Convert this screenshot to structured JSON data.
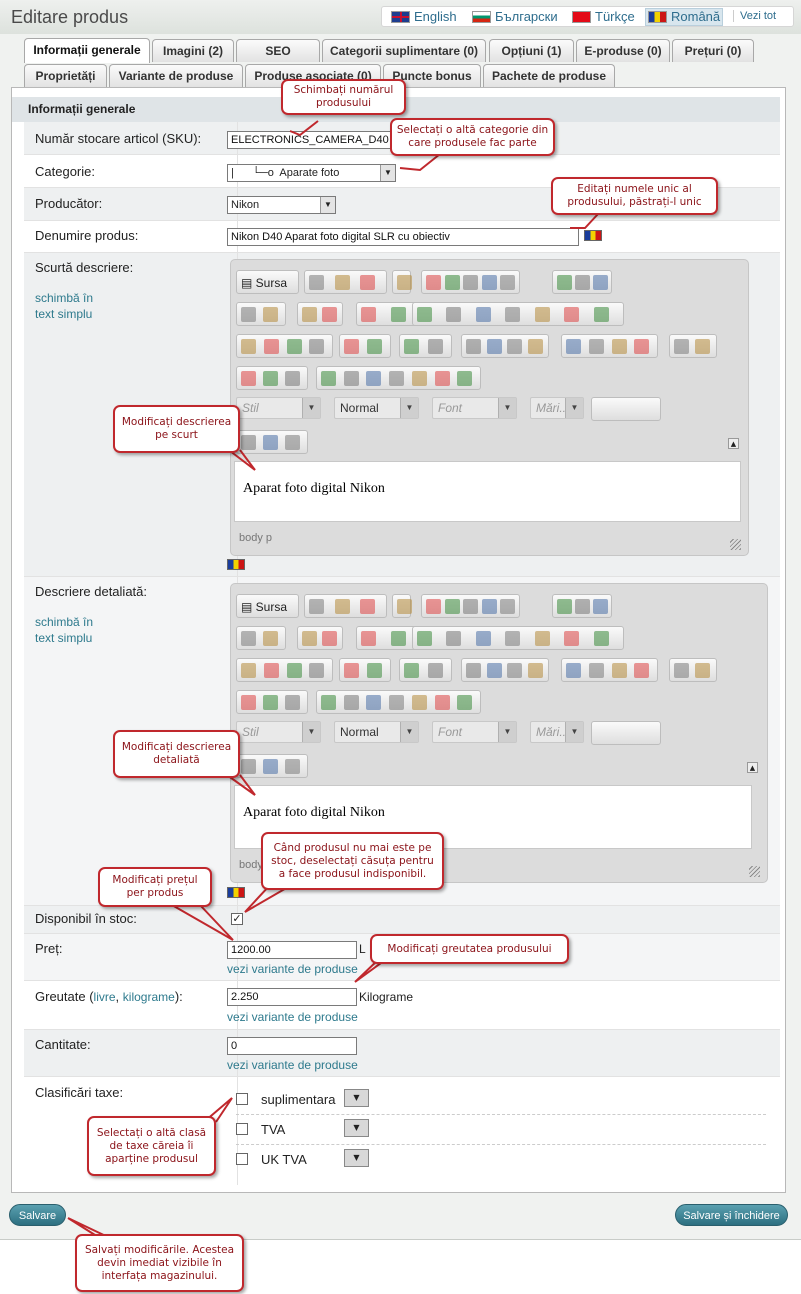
{
  "header": {
    "title": "Editare produs",
    "languages": [
      {
        "label": "English",
        "selected": false
      },
      {
        "label": "Български",
        "selected": false
      },
      {
        "label": "Türkçe",
        "selected": false
      },
      {
        "label": "Română",
        "selected": true
      }
    ],
    "view_all": "Vezi tot"
  },
  "tabs_row1": [
    "Informații generale",
    "Imagini (2)",
    "SEO",
    "Categorii suplimentare (0)",
    "Opțiuni (1)",
    "E-produse (0)",
    "Prețuri (0)"
  ],
  "tabs_row2": [
    "Proprietăți",
    "Variante de produse",
    "Produse asociate (0)",
    "Puncte bonus",
    "Pachete de produse"
  ],
  "section_title": "Informații generale",
  "fields": {
    "sku": {
      "label": "Număr stocare articol (SKU):",
      "value": "ELECTRONICS_CAMERA_D40"
    },
    "category": {
      "label": "Categorie:",
      "value": "|      └─o  Aparate foto"
    },
    "manufacturer": {
      "label": "Producător:",
      "value": "Nikon"
    },
    "name": {
      "label": "Denumire produs:",
      "value": "Nikon D40 Aparat foto digital SLR cu obiectiv"
    },
    "short_desc": {
      "label": "Scurtă descriere:",
      "toggle_1": "schimbă în",
      "toggle_2": "text simplu",
      "content": "Aparat foto digital Nikon",
      "status": "body  p"
    },
    "full_desc": {
      "label": "Descriere detaliată:",
      "toggle_1": "schimbă în",
      "toggle_2": "text simplu",
      "content": "Aparat foto digital Nikon",
      "status": "body"
    },
    "in_stock": {
      "label": "Disponibil în stoc:",
      "checked": true
    },
    "price": {
      "label": "Preț:",
      "value": "1200.00",
      "unit": "L",
      "link": "vezi variante de produse"
    },
    "weight": {
      "label_prefix": "Greutate (",
      "label_link1": "livre",
      "label_sep": ", ",
      "label_link2": "kilograme",
      "label_suffix": "):",
      "value": "2.250",
      "unit": "Kilograme",
      "link": "vezi variante de produse"
    },
    "quantity": {
      "label": "Cantitate:",
      "value": "0",
      "link": "vezi variante de produse"
    },
    "taxes": {
      "label": "Clasificări taxe:",
      "items": [
        "suplimentara",
        "TVA",
        "UK TVA"
      ]
    }
  },
  "editor": {
    "source_label": "Sursa",
    "styles": "Stil",
    "format": "Normal",
    "font": "Font",
    "size": "Mări..."
  },
  "buttons": {
    "save": "Salvare",
    "save_close": "Salvare și închidere"
  },
  "callouts": {
    "sku": "Schimbați numărul produsului",
    "category": "Selectați o altă categorie din care produsele fac parte",
    "name": "Editați numele unic al produsului, păstrați-l unic",
    "short_desc": "Modificați descrierea pe scurt",
    "full_desc": "Modificați descrierea detaliată",
    "stock": "Când produsul nu mai este pe stoc, deselectați căsuța pentru a face produsul indisponibil.",
    "price": "Modificați prețul per produs",
    "weight": "Modificați greutatea produsului",
    "tax": "Selectați o altă clasă de taxe căreia îi aparține produsul",
    "save": "Salvați modificările. Acestea devin imediat vizibile în interfața magazinului."
  },
  "colors": {
    "callout_border": "#c0282d",
    "link": "#2e7a8d",
    "button": "#2c6f80"
  }
}
